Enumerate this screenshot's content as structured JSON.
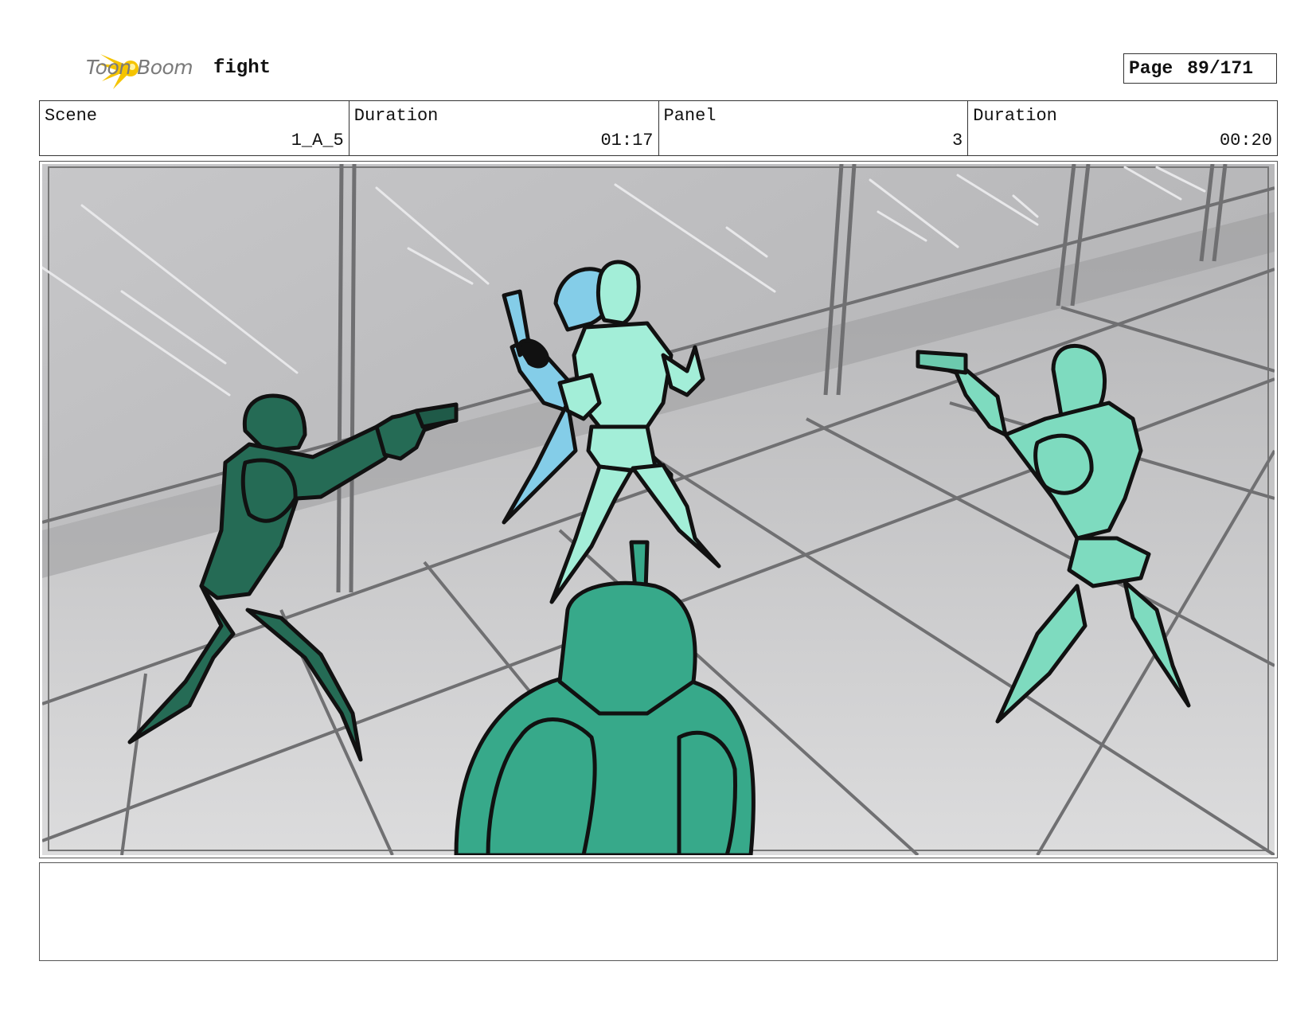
{
  "header": {
    "logo_text": "Toon Boom",
    "title": "fight",
    "page_label": "Page",
    "page_value": "89/171"
  },
  "info": {
    "scene_label": "Scene",
    "scene_value": "1_A_5",
    "duration1_label": "Duration",
    "duration1_value": "01:17",
    "panel_label": "Panel",
    "panel_value": "3",
    "duration2_label": "Duration",
    "duration2_value": "00:20"
  },
  "colors": {
    "logo_yellow": "#f5c400",
    "figure_dark_green": "#256b55",
    "figure_mid_green": "#37a98a",
    "figure_light_green": "#7edbbf",
    "figure_pale_green": "#a3eed8",
    "figure_blue": "#84cde8",
    "background_gray": "#b8b8ba"
  },
  "notes": ""
}
